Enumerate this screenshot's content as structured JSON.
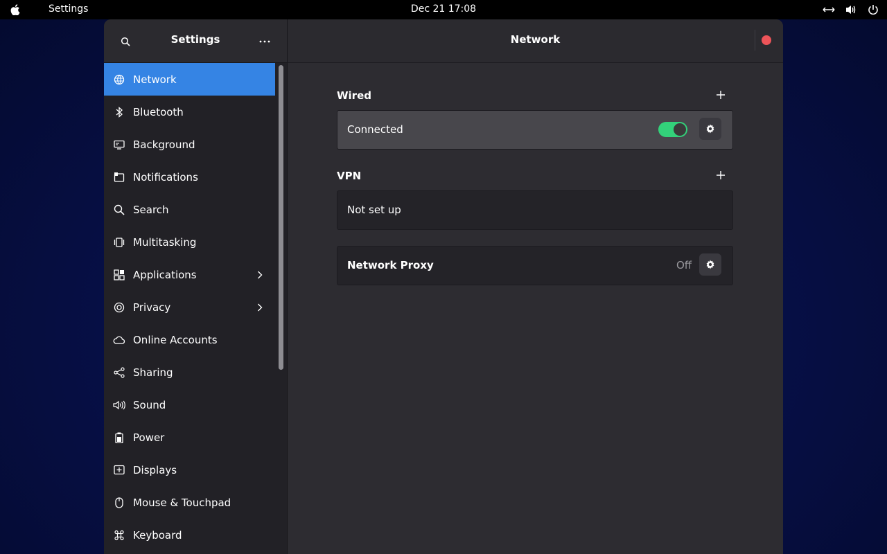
{
  "topbar": {
    "app_name": "Settings",
    "clock": "Dec 21  17:08",
    "tray_icons": [
      "network-wired-icon",
      "volume-icon",
      "power-icon"
    ]
  },
  "sidebar": {
    "title": "Settings",
    "items": [
      {
        "label": "Network",
        "icon": "globe-icon",
        "active": true
      },
      {
        "label": "Bluetooth",
        "icon": "bluetooth-icon"
      },
      {
        "label": "Background",
        "icon": "display-background-icon"
      },
      {
        "label": "Notifications",
        "icon": "notifications-icon"
      },
      {
        "label": "Search",
        "icon": "search-icon"
      },
      {
        "label": "Multitasking",
        "icon": "multitasking-icon"
      },
      {
        "label": "Applications",
        "icon": "applications-icon",
        "chevron": true
      },
      {
        "label": "Privacy",
        "icon": "privacy-icon",
        "chevron": true
      },
      {
        "label": "Online Accounts",
        "icon": "cloud-icon"
      },
      {
        "label": "Sharing",
        "icon": "share-icon"
      },
      {
        "label": "Sound",
        "icon": "speaker-icon"
      },
      {
        "label": "Power",
        "icon": "battery-icon"
      },
      {
        "label": "Displays",
        "icon": "display-icon"
      },
      {
        "label": "Mouse & Touchpad",
        "icon": "mouse-icon"
      },
      {
        "label": "Keyboard",
        "icon": "command-key-icon"
      }
    ]
  },
  "content": {
    "title": "Network",
    "wired": {
      "title": "Wired",
      "status": "Connected",
      "enabled": true
    },
    "vpn": {
      "title": "VPN",
      "status": "Not set up"
    },
    "proxy": {
      "label": "Network Proxy",
      "value": "Off"
    }
  },
  "colors": {
    "accent": "#3584e4",
    "toggle_on": "#33d17a",
    "close": "#ed5459"
  }
}
